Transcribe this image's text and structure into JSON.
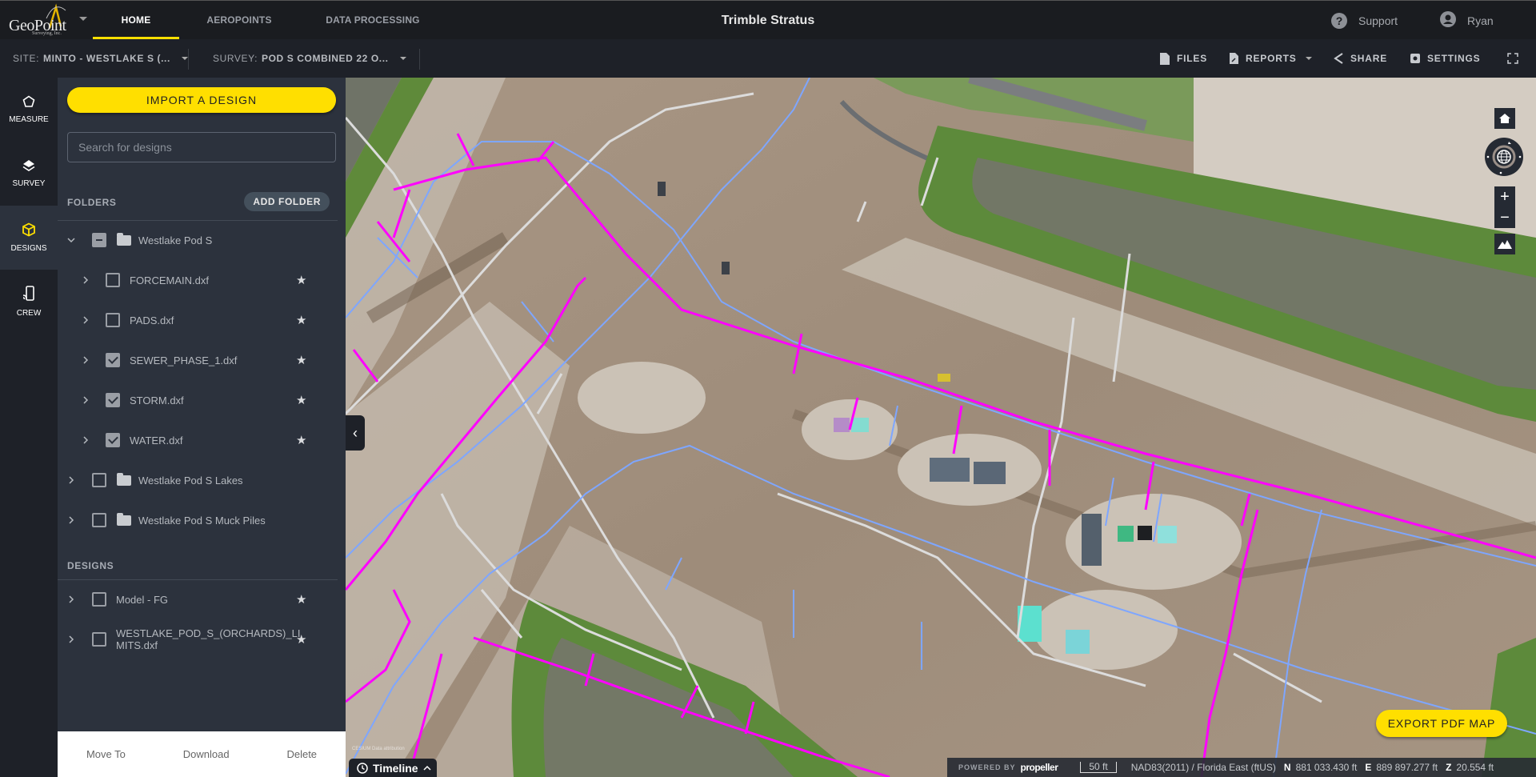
{
  "brand": {
    "logo_text": "GeoPoint",
    "logo_sub": "Surveying, Inc.",
    "app_title": "Trimble Stratus"
  },
  "nav": {
    "tabs": [
      {
        "label": "HOME",
        "active": true
      },
      {
        "label": "AEROPOINTS",
        "active": false
      },
      {
        "label": "DATA PROCESSING",
        "active": false
      }
    ],
    "support_label": "Support",
    "user_name": "Ryan"
  },
  "subbar": {
    "site_key": "SITE:",
    "site_value": "MINTO - WESTLAKE S (...",
    "survey_key": "SURVEY:",
    "survey_value": "POD S COMBINED 22 O...",
    "tools": [
      {
        "label": "FILES",
        "icon": "file-icon"
      },
      {
        "label": "REPORTS",
        "icon": "report-icon",
        "dropdown": true
      },
      {
        "label": "SHARE",
        "icon": "share-icon"
      },
      {
        "label": "SETTINGS",
        "icon": "gear-icon"
      }
    ]
  },
  "rail": [
    {
      "label": "MEASURE",
      "icon": "pentagon-icon",
      "active": false
    },
    {
      "label": "SURVEY",
      "icon": "layers-icon",
      "active": false
    },
    {
      "label": "DESIGNS",
      "icon": "cube-icon",
      "active": true
    },
    {
      "label": "CREW",
      "icon": "device-signal-icon",
      "active": false
    }
  ],
  "panel": {
    "import_label": "IMPORT A DESIGN",
    "search_placeholder": "Search for designs",
    "search_value": "",
    "folders_label": "FOLDERS",
    "add_folder_label": "ADD FOLDER",
    "designs_label": "DESIGNS",
    "folders": [
      {
        "name": "Westlake Pod S",
        "expanded": true,
        "state": "indeterminate",
        "children": [
          {
            "name": "FORCEMAIN.dxf",
            "checked": false
          },
          {
            "name": "PADS.dxf",
            "checked": false
          },
          {
            "name": "SEWER_PHASE_1.dxf",
            "checked": true
          },
          {
            "name": "STORM.dxf",
            "checked": true
          },
          {
            "name": "WATER.dxf",
            "checked": true
          }
        ]
      },
      {
        "name": "Westlake Pod S Lakes",
        "expanded": false,
        "state": "unchecked"
      },
      {
        "name": "Westlake Pod S Muck Piles",
        "expanded": false,
        "state": "unchecked"
      }
    ],
    "designs": [
      {
        "name": "Model - FG",
        "checked": false
      },
      {
        "name": "WESTLAKE_POD_S_(ORCHARDS)_LIMITS.dxf",
        "line1": "WESTLAKE_POD_S_(ORCHARDS)_LI",
        "line2": "MITS.dxf",
        "checked": false
      }
    ],
    "actions": [
      "Move To",
      "Download",
      "Delete"
    ]
  },
  "map": {
    "export_label": "EXPORT PDF MAP",
    "timeline_label": "Timeline",
    "cesium_credit": "CESIUM  Data attribution",
    "status": {
      "powered_by": "POWERED BY",
      "brand": "propeller",
      "scale": "50 ft",
      "crs": "NAD83(2011) / Florida East (ftUS)",
      "n_label": "N",
      "n_value": "881 033.430 ft",
      "e_label": "E",
      "e_value": "889 897.277 ft",
      "z_label": "Z",
      "z_value": "20.554 ft"
    },
    "layer_colors": {
      "sewer": "#ff00ff",
      "storm": "#7ea6ff",
      "water": "#d8d8d8"
    }
  },
  "colors": {
    "accent": "#ffdf00",
    "nav_bg": "#1a1c20",
    "panel_bg": "#2c323d"
  }
}
